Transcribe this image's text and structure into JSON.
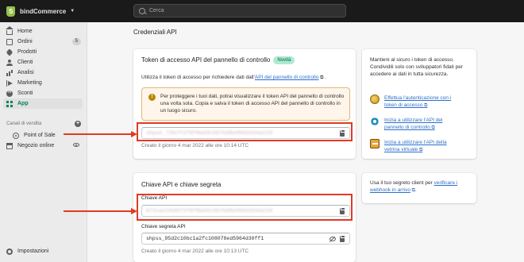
{
  "topbar": {
    "store_name": "bindCommerce",
    "search_placeholder": "Cerca"
  },
  "sidebar": {
    "items": [
      {
        "label": "Home",
        "icon": "home-icon"
      },
      {
        "label": "Ordini",
        "icon": "orders-icon",
        "badge": "5"
      },
      {
        "label": "Prodotti",
        "icon": "tag-icon"
      },
      {
        "label": "Clienti",
        "icon": "person-icon"
      },
      {
        "label": "Analisi",
        "icon": "analytics-icon"
      },
      {
        "label": "Marketing",
        "icon": "megaphone-icon"
      },
      {
        "label": "Sconti",
        "icon": "discount-icon"
      },
      {
        "label": "App",
        "icon": "apps-icon",
        "active": true
      }
    ],
    "channels_heading": "Canali di vendita",
    "channels": [
      {
        "label": "Point of Sale",
        "icon": "pos-icon"
      },
      {
        "label": "Negozio online",
        "icon": "online-store-icon"
      }
    ],
    "settings_label": "Impostazioni"
  },
  "main": {
    "section_title": "Credenziali API",
    "admin_card": {
      "title": "Token di accesso API del pannello di controllo",
      "badge": "Novità",
      "description_prefix": "Utilizza il token di accesso per richiedere dati dall'",
      "description_link": "API del pannello di controllo",
      "description_suffix": ".",
      "warning": "Per proteggere i tuoi dati, potrai visualizzare il token API del pannello di controllo una volta sola. Copia e salva il token di accesso API del pannello di controllo in un luogo sicuro.",
      "token_value": "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",
      "created": "Creato il giorno 4 mar 2022 alle ore 10:14 UTC"
    },
    "keys_card": {
      "title": "Chiave API e chiave segreta",
      "api_key_label": "Chiave API",
      "api_key_value": "b71ca216d5f2f8f8bd3c567bd8e90d2d1ba216",
      "secret_label": "Chiave segreta API",
      "secret_value": "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",
      "created": "Creato il giorno 4 mar 2022 alle ore 10:13 UTC"
    },
    "side_card_1": {
      "text": "Mantieni al sicuro i token di accesso. Condividili solo con sviluppatori fidati per accedere ai dati in tutta sicurezza.",
      "resources": [
        {
          "label": "Effettua l'autenticazione con i token di accesso",
          "icon": "coin-icon"
        },
        {
          "label": "Inizia a utilizzare l'API del pannello di controllo",
          "icon": "gear-icon"
        },
        {
          "label": "Inizia a utilizzare l'API della vetrina virtuale",
          "icon": "board-icon"
        }
      ]
    },
    "side_card_2": {
      "text_prefix": "Usa il tuo segreto client per ",
      "link": "verificare i webhook in arrivo",
      "text_suffix": "."
    }
  },
  "colors": {
    "topbar": "#1a1a1a",
    "accent": "#008060",
    "link": "#2c6ecb",
    "highlight": "#e03b24",
    "warning_bg": "#fff5ea"
  }
}
